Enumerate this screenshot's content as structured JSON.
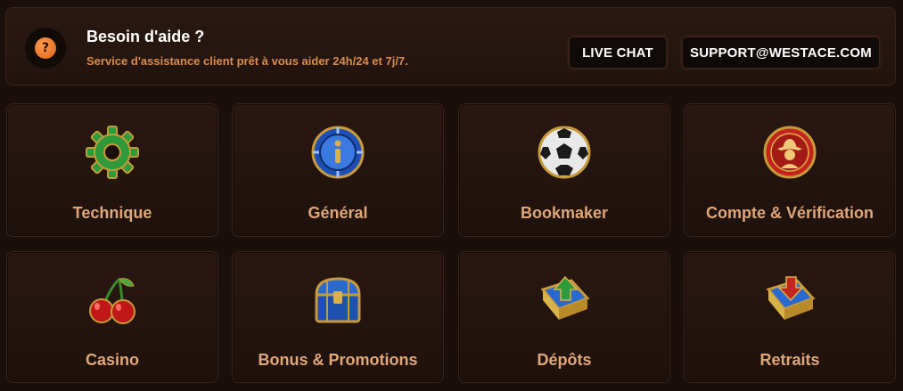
{
  "help": {
    "title": "Besoin d'aide ?",
    "subtitle": "Service d'assistance client prêt à vous aider 24h/24 et 7j/7.",
    "badge_icon": "question-icon",
    "live_chat_label": "LIVE CHAT",
    "email_label": "SUPPORT@WESTACE.COM"
  },
  "categories": [
    {
      "label": "Technique",
      "icon": "gear-icon"
    },
    {
      "label": "Général",
      "icon": "info-chip-icon"
    },
    {
      "label": "Bookmaker",
      "icon": "football-icon"
    },
    {
      "label": "Compte & Vérification",
      "icon": "cowboy-profile-icon"
    },
    {
      "label": "Casino",
      "icon": "cherries-icon"
    },
    {
      "label": "Bonus & Promotions",
      "icon": "treasure-chest-icon"
    },
    {
      "label": "Dépôts",
      "icon": "deposit-arrow-up-icon"
    },
    {
      "label": "Retraits",
      "icon": "withdraw-arrow-down-icon"
    }
  ],
  "colors": {
    "background": "#1a0f0b",
    "card_label": "#e0a77a",
    "subtitle": "#d98d4f",
    "badge": "#e87a2c"
  }
}
